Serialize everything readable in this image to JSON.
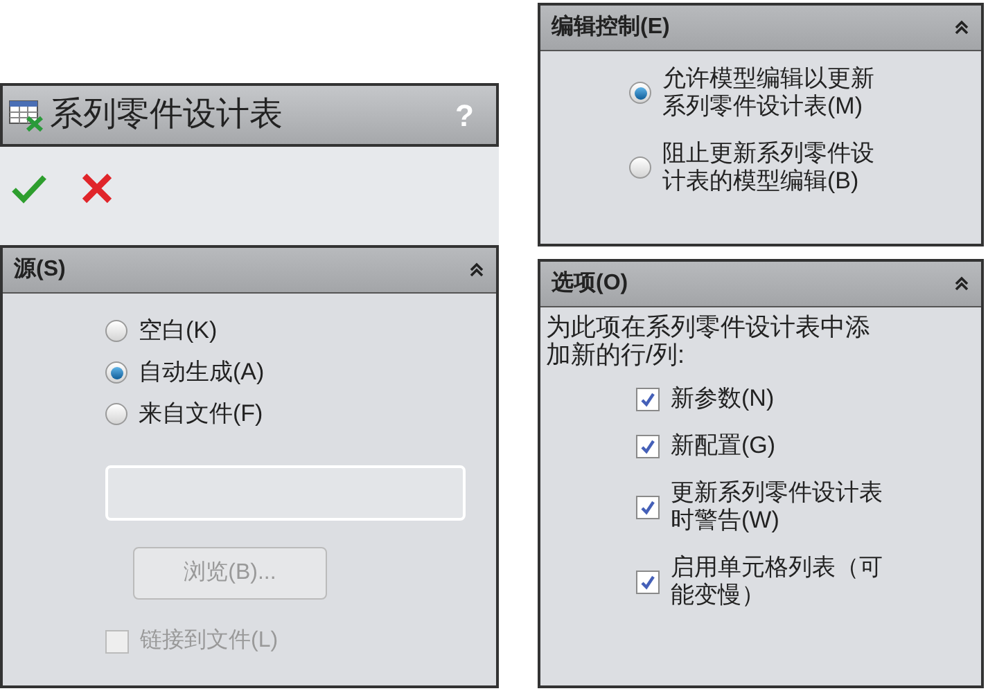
{
  "panel": {
    "title": "系列零件设计表",
    "help": "?"
  },
  "source": {
    "title": "源(S)",
    "options": [
      {
        "label": "空白(K)",
        "selected": false
      },
      {
        "label": "自动生成(A)",
        "selected": true
      },
      {
        "label": "来自文件(F)",
        "selected": false
      }
    ],
    "file_field": {
      "disabled": true
    },
    "browse": {
      "label": "浏览(B)...",
      "disabled": true
    },
    "link": {
      "label": "链接到文件(L)",
      "checked": false,
      "disabled": true
    }
  },
  "edit_control": {
    "title": "编辑控制(E)",
    "options": [
      {
        "label": "允许模型编辑以更新系列零件设计表(M)",
        "selected": true
      },
      {
        "label": "阻止更新系列零件设计表的模型编辑(B)",
        "selected": false
      }
    ]
  },
  "options": {
    "title": "选项(O)",
    "intro": "为此项在系列零件设计表中添加新的行/列:",
    "items": [
      {
        "label": "新参数(N)",
        "checked": true
      },
      {
        "label": "新配置(G)",
        "checked": true
      },
      {
        "label": "更新系列零件设计表时警告(W)",
        "checked": true
      },
      {
        "label": "启用单元格列表（可能变慢）",
        "checked": true
      }
    ]
  }
}
